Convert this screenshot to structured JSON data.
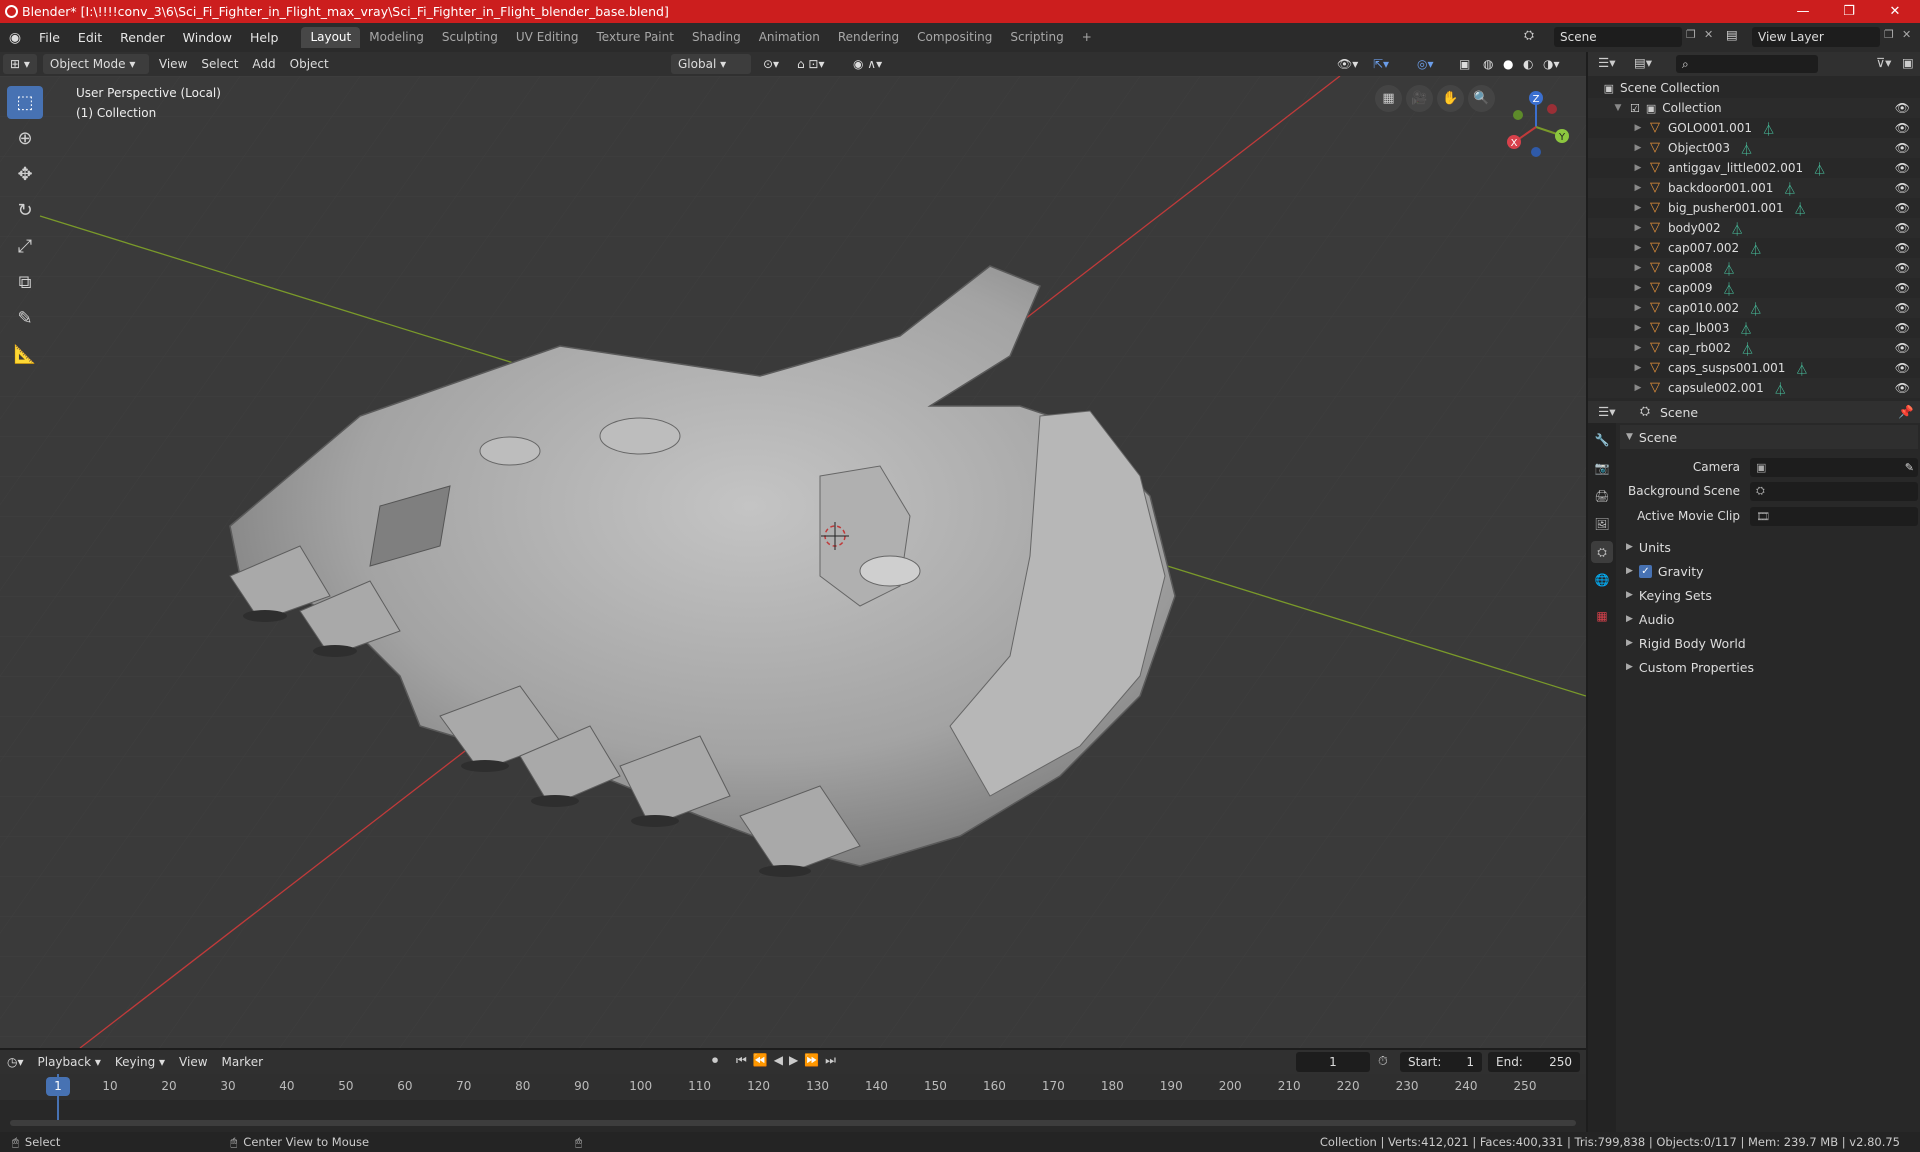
{
  "window": {
    "title": "Blender* [I:\\!!!!conv_3\\6\\Sci_Fi_Fighter_in_Flight_max_vray\\Sci_Fi_Fighter_in_Flight_blender_base.blend]",
    "minimize": "—",
    "maximize": "❐",
    "close": "✕"
  },
  "menu": {
    "items": [
      "File",
      "Edit",
      "Render",
      "Window",
      "Help"
    ],
    "workspaces": [
      "Layout",
      "Modeling",
      "Sculpting",
      "UV Editing",
      "Texture Paint",
      "Shading",
      "Animation",
      "Rendering",
      "Compositing",
      "Scripting"
    ],
    "active_workspace": "Layout",
    "add_workspace": "+",
    "scene_label": "Scene",
    "view_layer_label": "View Layer"
  },
  "viewport_header": {
    "mode": "Object Mode",
    "menus": [
      "View",
      "Select",
      "Add",
      "Object"
    ],
    "orientation": "Global"
  },
  "viewport": {
    "perspective": "User Perspective (Local)",
    "collection": "(1) Collection",
    "axes": {
      "x": "X",
      "y": "Y",
      "z": "Z"
    }
  },
  "outliner": {
    "scene_collection": "Scene Collection",
    "collection": "Collection",
    "objects": [
      "GOLO001.001",
      "Object003",
      "antiggav_little002.001",
      "backdoor001.001",
      "big_pusher001.001",
      "body002",
      "cap007.002",
      "cap008",
      "cap009",
      "cap010.002",
      "cap_lb003",
      "cap_rb002",
      "caps_susps001.001",
      "capsule002.001"
    ]
  },
  "properties": {
    "header_title": "Scene",
    "section": "Scene",
    "camera_label": "Camera",
    "background_scene_label": "Background Scene",
    "active_movie_clip_label": "Active Movie Clip",
    "subsections": [
      "Units",
      "Gravity",
      "Keying Sets",
      "Audio",
      "Rigid Body World",
      "Custom Properties"
    ],
    "gravity_checked": true
  },
  "timeline": {
    "menus": [
      "Playback",
      "Keying",
      "View",
      "Marker"
    ],
    "current_frame": "1",
    "start_label": "Start:",
    "start_value": "1",
    "end_label": "End:",
    "end_value": "250",
    "ticks": [
      "1",
      "10",
      "20",
      "30",
      "40",
      "50",
      "60",
      "70",
      "80",
      "90",
      "100",
      "110",
      "120",
      "130",
      "140",
      "150",
      "160",
      "170",
      "180",
      "190",
      "200",
      "210",
      "220",
      "230",
      "240",
      "250"
    ]
  },
  "statusbar": {
    "select": "Select",
    "center_view": "Center View to Mouse",
    "stats": "Collection | Verts:412,021 | Faces:400,331 | Tris:799,838 | Objects:0/117 | Mem: 239.7 MB | v2.80.75"
  },
  "colors": {
    "titlebar": "#cc1e1e",
    "accent": "#4772b3",
    "mesh_icon": "#e3903a",
    "vertex_icon": "#49c6a2",
    "x_axis": "#c03a3a",
    "y_axis": "#7a9a2a"
  }
}
